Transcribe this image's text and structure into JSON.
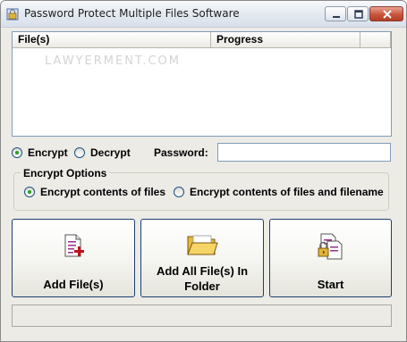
{
  "window": {
    "title": "Password Protect Multiple Files Software",
    "icons": [
      "app-icon",
      "minimize-icon",
      "maximize-icon",
      "close-icon"
    ]
  },
  "listview": {
    "columns": [
      "File(s)",
      "Progress"
    ],
    "watermark": "LAWYERMENT.COM",
    "rows": []
  },
  "mode": {
    "encrypt_label": "Encrypt",
    "decrypt_label": "Decrypt",
    "selected": "Encrypt"
  },
  "password": {
    "label": "Password:",
    "value": ""
  },
  "options": {
    "legend": "Encrypt Options",
    "contents_label": "Encrypt contents of files",
    "contents_and_name_label": "Encrypt contents of files and filename",
    "selected": "Encrypt contents of files"
  },
  "buttons": {
    "add_files": "Add File(s)",
    "add_all_line1": "Add All File(s) In",
    "add_all_line2": "Folder",
    "start": "Start",
    "icons": [
      "add-file-icon",
      "folder-icon",
      "lock-start-icon"
    ]
  },
  "status": {
    "text": ""
  },
  "colors": {
    "face": "#ecebe6",
    "list_border": "#7f9db9",
    "button_border": "#1c3f70",
    "radio_selected": "#21a121"
  }
}
